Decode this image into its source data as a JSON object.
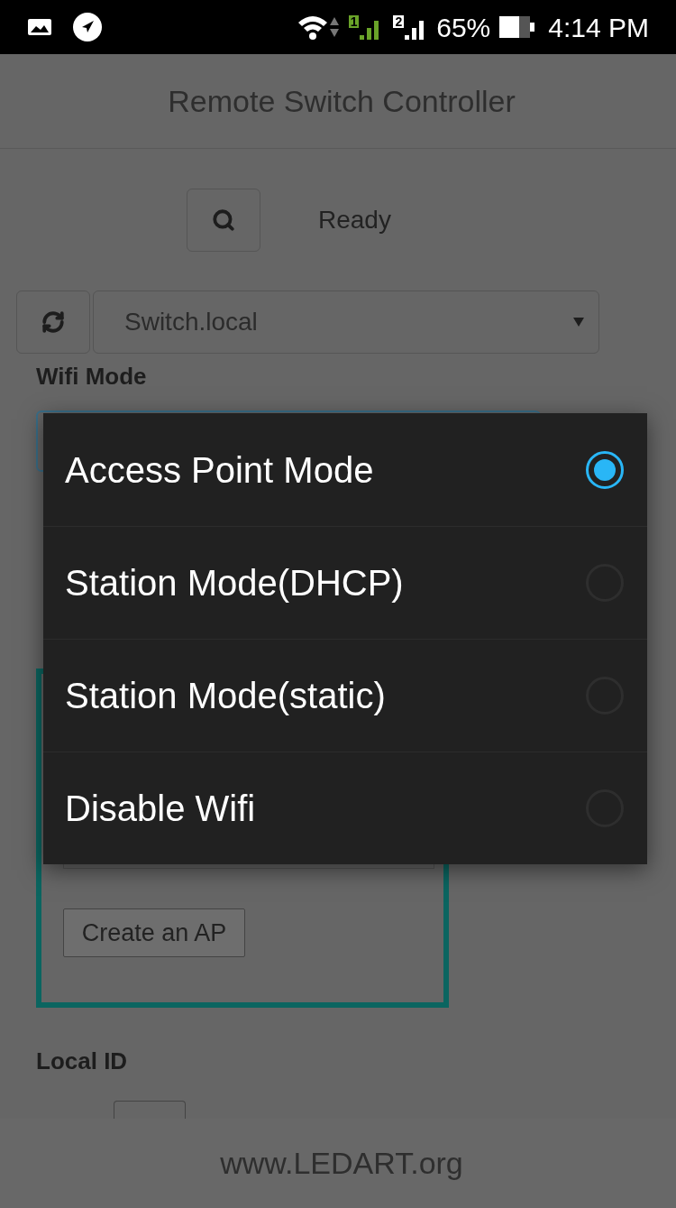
{
  "status_bar": {
    "sims": [
      {
        "label": "1",
        "color": "#6aa329"
      },
      {
        "label": "2",
        "color": "#ffffff"
      }
    ],
    "battery_text": "65%",
    "time": "4:14 PM"
  },
  "header": {
    "title": "Remote Switch Controller"
  },
  "toolbar": {
    "status": "Ready"
  },
  "device_select": {
    "value": "Switch.local"
  },
  "wifi_mode": {
    "label": "Wifi Mode"
  },
  "ap_panel": {
    "button": "Create an AP"
  },
  "local_id": {
    "label": "Local ID"
  },
  "footer": {
    "text": "www.LEDART.org"
  },
  "dialog": {
    "options": [
      {
        "label": "Access Point Mode",
        "selected": true
      },
      {
        "label": "Station Mode(DHCP)",
        "selected": false
      },
      {
        "label": "Station Mode(static)",
        "selected": false
      },
      {
        "label": "Disable Wifi",
        "selected": false
      }
    ]
  }
}
